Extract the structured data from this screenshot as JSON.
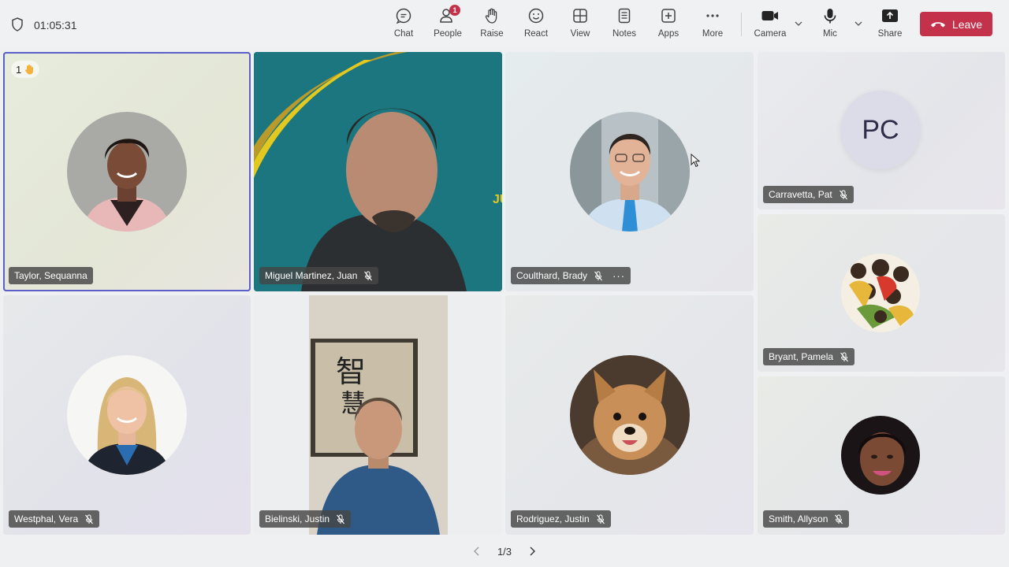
{
  "call": {
    "timer": "01:05:31"
  },
  "toolbar": {
    "chat": "Chat",
    "people": "People",
    "people_badge": "1",
    "raise": "Raise",
    "react": "React",
    "view": "View",
    "notes": "Notes",
    "apps": "Apps",
    "more": "More",
    "camera": "Camera",
    "mic": "Mic",
    "share": "Share",
    "leave": "Leave"
  },
  "participants": {
    "taylor": {
      "name": "Taylor, Sequanna",
      "raised_hand_count": "1"
    },
    "miguel": {
      "name": "Miguel Martinez, Juan"
    },
    "coulthard": {
      "name": "Coulthard, Brady",
      "more": "···"
    },
    "carravetta": {
      "name": "Carravetta, Pat",
      "initials": "PC"
    },
    "bryant": {
      "name": "Bryant, Pamela"
    },
    "westphal": {
      "name": "Westphal, Vera"
    },
    "bielinski": {
      "name": "Bielinski, Justin"
    },
    "rodriguez": {
      "name": "Rodriguez, Justin"
    },
    "smith": {
      "name": "Smith, Allyson"
    }
  },
  "pager": {
    "label": "1/3"
  },
  "colors": {
    "leave": "#c4314b",
    "active_border": "#5b5fc7",
    "badge": "#c4314b"
  }
}
